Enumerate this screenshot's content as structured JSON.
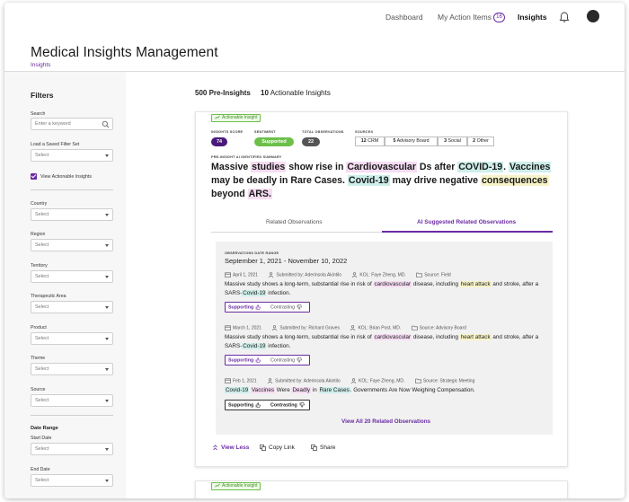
{
  "nav": {
    "dashboard": "Dashboard",
    "my_action_items": "My Action Items",
    "action_count": "16",
    "insights": "Insights"
  },
  "header": {
    "title": "Medical Insights Management",
    "breadcrumb": "Insights"
  },
  "filters": {
    "title": "Filters",
    "search_label": "Search",
    "search_placeholder": "Enter a keyword",
    "saved_filter_label": "Load a Saved Filter Set",
    "select_placeholder": "Select",
    "view_actionable": "View Actionable Insights",
    "country": "Country",
    "region": "Region",
    "territory": "Territory",
    "therapeutic_area": "Therapeutic Area",
    "product": "Product",
    "theme": "Theme",
    "source": "Source",
    "date_range": "Date Range",
    "start_date": "Start Date",
    "end_date": "End Date"
  },
  "counts": {
    "pre_insights_num": "500",
    "pre_insights_label": "Pre-Insights",
    "actionable_num": "10",
    "actionable_label": "Actionable Insights"
  },
  "card": {
    "tag": "Actionable Insight",
    "score_label": "INSIGHTS SCORE",
    "score": "74",
    "sentiment_label": "SENTIMENT",
    "sentiment": "Supported",
    "total_obs_label": "TOTAL OBSERVATIONS",
    "total_obs": "22",
    "sources_label": "SOURCES",
    "sources": [
      {
        "num": "12",
        "label": "CRM"
      },
      {
        "num": "5",
        "label": "Advisory Board"
      },
      {
        "num": "3",
        "label": "Social"
      },
      {
        "num": "2",
        "label": "Other"
      }
    ],
    "summary_label": "PRE-INSIGHT AI IDENTIFIED SUMMARY",
    "summary": {
      "s1": "Massive ",
      "h1": "studies",
      "s2": " show rise in ",
      "h2": "Cardiovascular",
      "s3": " Ds after ",
      "h3": "COVID-19",
      "s4": ". ",
      "h4": "Vaccines",
      "s5": " may be deadly in Rare Cases. ",
      "h5": "Covid-19",
      "s6": " may drive negative ",
      "h6": "consequences",
      "s7": " beyond ",
      "h7": "ARS."
    },
    "tab_related": "Related Observations",
    "tab_ai": "AI Suggested Related Observations",
    "obs_date_label": "OBSERVATIONS DATE RANGE",
    "obs_date_range": "September 1, 2021 - November 10, 2022",
    "observations": [
      {
        "date": "April 1, 2021",
        "submitted": "Submitted by: Aderinsola Akintilo",
        "kol": "KOL: Faye Zheng, MD.",
        "source": "Source: Field",
        "t1": "Massive study shows a long-term, substantial rise in risk of ",
        "k1": "cardiovascular",
        "t2": " disease, including ",
        "k2": "heart attack",
        "t3": " and stroke, after a SARS-",
        "k3": "Covid-19",
        "t4": " infection."
      },
      {
        "date": "March 1, 2021",
        "submitted": "Submitted by: Richard Graves",
        "kol": "KOL: Brian Post, MD.",
        "source": "Source: Advisory Board",
        "t1": "Massive study shows a long-term, substantial rise in risk of ",
        "k1": "cardiovascular",
        "t2": " disease, including ",
        "k2": "heart attack",
        "t3": " and stroke, after a SARS-",
        "k3": "Covid-19",
        "t4": " infection."
      },
      {
        "date": "Feb 1, 2021",
        "submitted": "Submitted by: Aderinsola Akintilo",
        "kol": "KOL: Faye Zheng, MD.",
        "source": "Source: Strategic Meeting",
        "k1": "Covid-19",
        "k2": "Vaccines",
        "t1": " Were ",
        "k3": "Deadly",
        "t2": " in ",
        "k4": "Rare Cases",
        "t3": ". Governments Are Now Weighing Compensation."
      }
    ],
    "supporting": "Supporting",
    "contrasting": "Contrasting",
    "view_all": "View All 20 Related Observations",
    "view_less": "View Less",
    "copy_link": "Copy Link",
    "share": "Share"
  },
  "colors": {
    "accent": "#6a2ba3",
    "green": "#6cc04a"
  }
}
